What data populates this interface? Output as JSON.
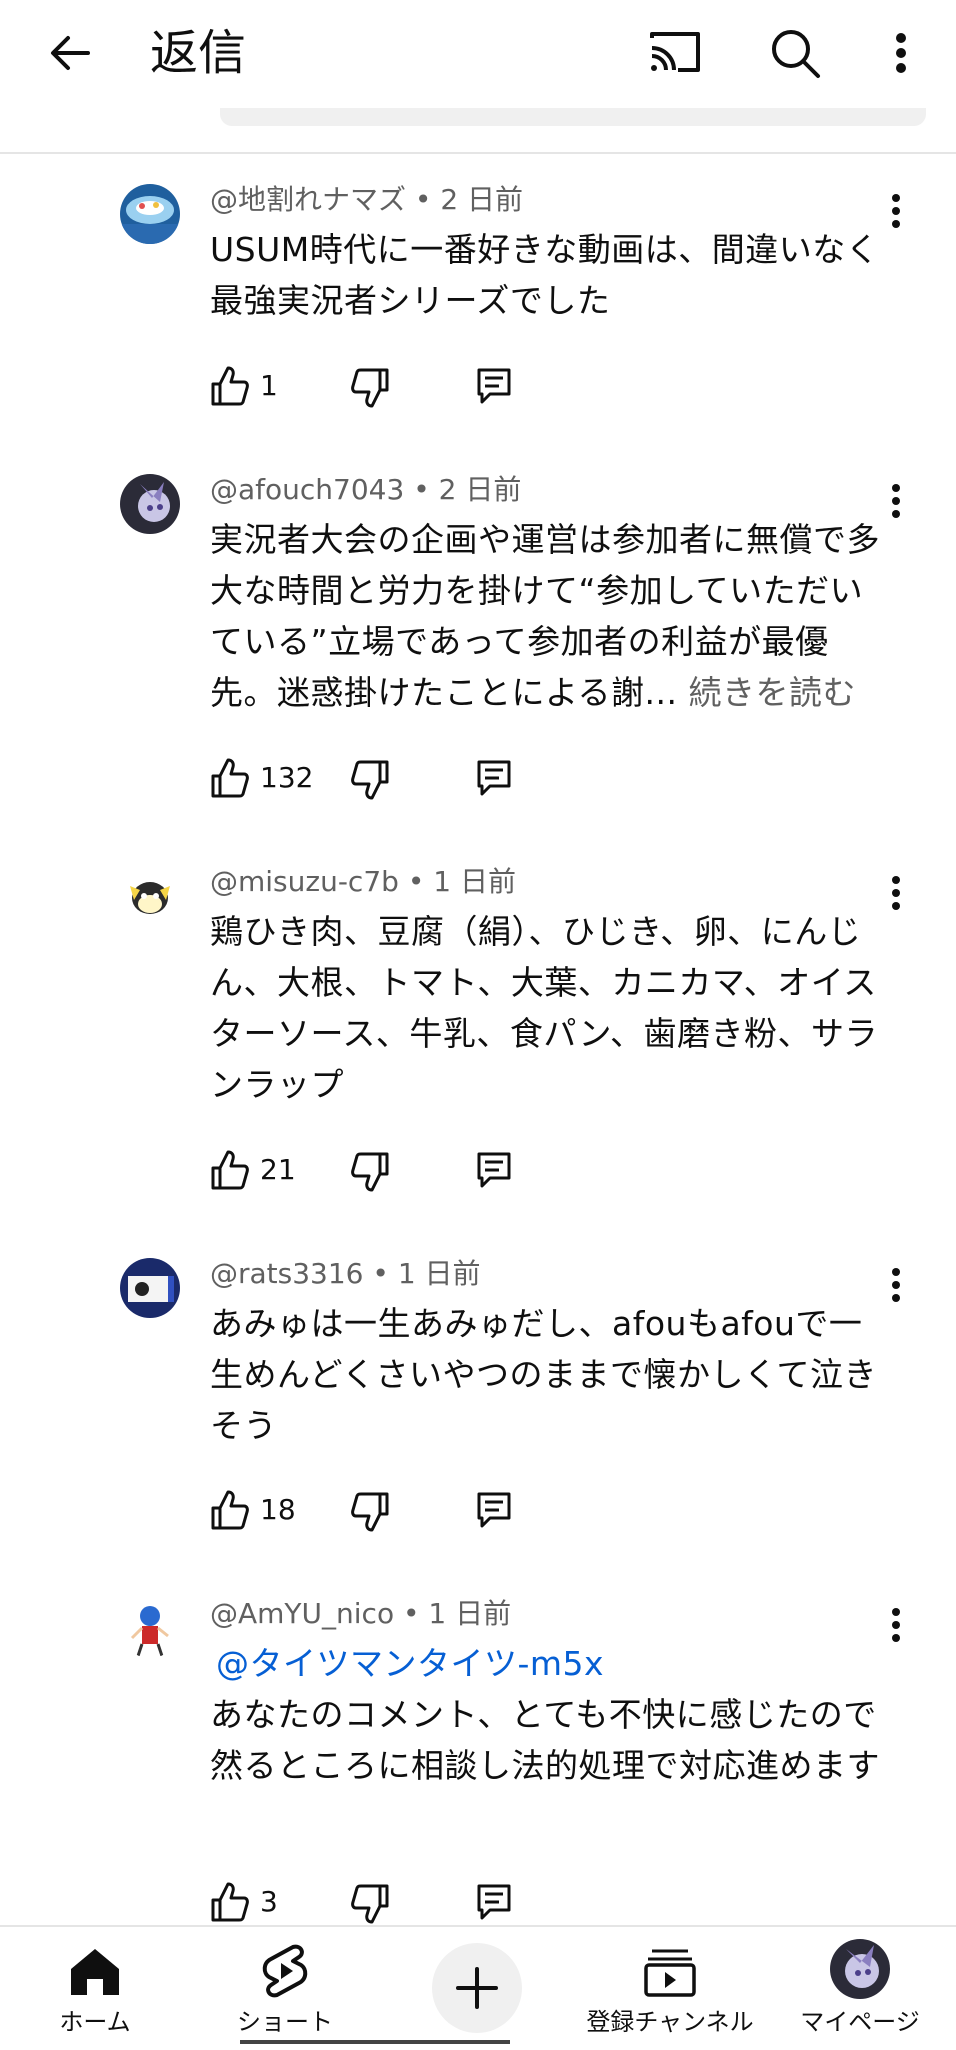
{
  "header": {
    "title": "返信"
  },
  "comments": [
    {
      "author": "@地割れナマズ",
      "sep": "•",
      "time": "2 日前",
      "body": "USUM時代に一番好きな動画は、間違いなく最強実況者シリーズでした",
      "likes": "1"
    },
    {
      "author": "@afouch7043",
      "sep": "•",
      "time": "2 日前",
      "body": "実況者大会の企画や運営は参加者に無償で多大な時間と労力を掛けて“参加していただいている”立場であって参加者の利益が最優先。迷惑掛けたことによる謝...",
      "read_more": "続きを読む",
      "likes": "132"
    },
    {
      "author": "@misuzu-c7b",
      "sep": "•",
      "time": "1 日前",
      "body": "鶏ひき肉、豆腐（絹）、ひじき、卵、にんじん、大根、トマト、大葉、カニカマ、オイスターソース、牛乳、食パン、歯磨き粉、サランラップ",
      "likes": "21"
    },
    {
      "author": "@rats3316",
      "sep": "•",
      "time": "1 日前",
      "body": "あみゅは一生あみゅだし、afouもafouで一生めんどくさいやつのままで懐かしくて泣きそう",
      "likes": "18"
    },
    {
      "author": "@AmYU_nico",
      "sep": "•",
      "time": "1 日前",
      "mention": "@タイツマンタイツ-m5x",
      "body": "あなたのコメント、とても不快に感じたので然るところに相談し法的処理で対応進めます",
      "likes": "3"
    }
  ],
  "nav": {
    "home": "ホーム",
    "shorts": "ショート",
    "subscriptions": "登録チャンネル",
    "you": "マイページ"
  },
  "colors": {
    "link": "#065fd4",
    "meta": "#606060",
    "text": "#0f0f0f"
  }
}
